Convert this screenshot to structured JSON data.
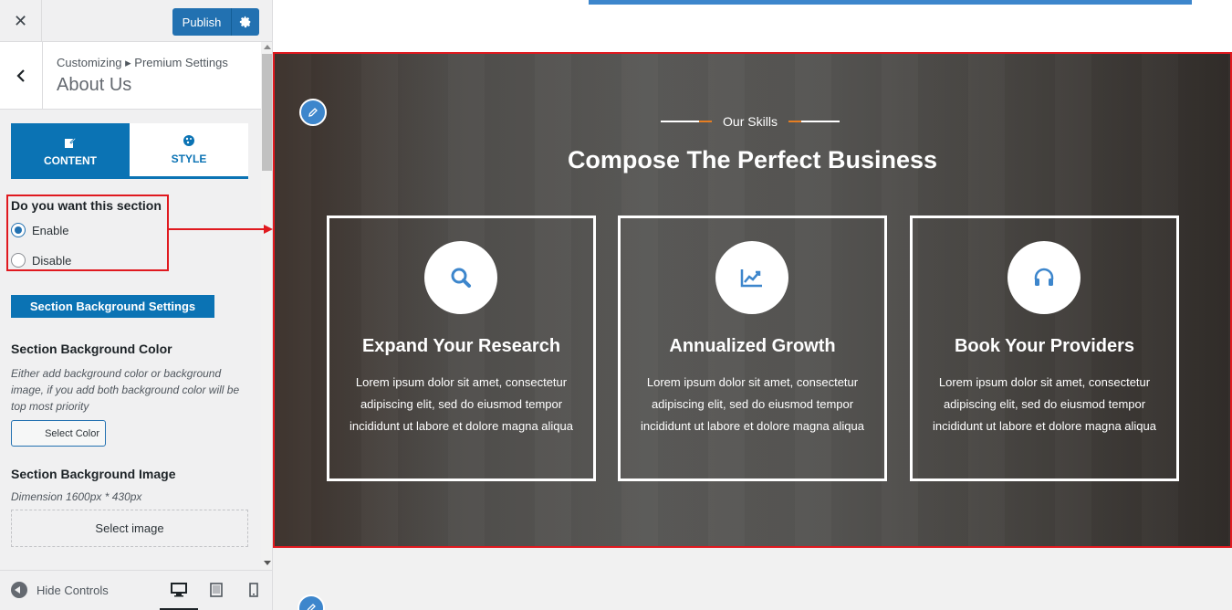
{
  "topbar": {
    "close_symbol": "✕",
    "publish_label": "Publish"
  },
  "header": {
    "breadcrumb": "Customizing ▸ Premium Settings",
    "title": "About Us"
  },
  "tabs": [
    {
      "label": "CONTENT",
      "icon": "edit-icon"
    },
    {
      "label": "STYLE",
      "icon": "palette-icon"
    }
  ],
  "section_toggle": {
    "question": "Do you want this section",
    "options": [
      {
        "label": "Enable",
        "checked": true
      },
      {
        "label": "Disable",
        "checked": false
      }
    ]
  },
  "background": {
    "settings_button": "Section Background Settings",
    "color_label": "Section Background Color",
    "color_description": "Either add background color or background image, if you add both background color will be top most priority",
    "select_color": "Select Color",
    "image_label": "Section Background Image",
    "image_dimension": "Dimension 1600px * 430px",
    "select_image": "Select image"
  },
  "footer": {
    "hide_controls": "Hide Controls",
    "devices": [
      "desktop-icon",
      "tablet-icon",
      "mobile-icon"
    ]
  },
  "preview": {
    "skills_label": "Our Skills",
    "heading": "Compose The Perfect Business",
    "cards": [
      {
        "icon": "search-icon",
        "title": "Expand Your Research",
        "text": "Lorem ipsum dolor sit amet, consectetur adipiscing elit, sed do eiusmod tempor incididunt ut labore et dolore magna aliqua"
      },
      {
        "icon": "chart-line-icon",
        "title": "Annualized Growth",
        "text": "Lorem ipsum dolor sit amet, consectetur adipiscing elit, sed do eiusmod tempor incididunt ut labore et dolore magna aliqua"
      },
      {
        "icon": "headphones-icon",
        "title": "Book Your Providers",
        "text": "Lorem ipsum dolor sit amet, consectetur adipiscing elit, sed do eiusmod tempor incididunt ut labore et dolore magna aliqua"
      }
    ]
  },
  "colors": {
    "accent": "#0b73b4",
    "wp_blue": "#2271b1",
    "highlight_red": "#e0191f",
    "icon_blue": "#3d86cc",
    "skills_dash": "#e67e22"
  }
}
